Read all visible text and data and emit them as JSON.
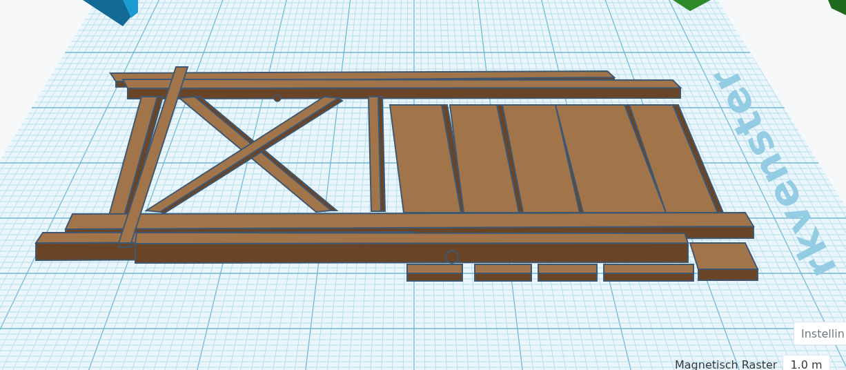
{
  "workplane": {
    "label": "rkvenster"
  },
  "settings_button": {
    "label": "Instellin"
  },
  "snap_grid": {
    "label": "Magnetisch Raster",
    "value": "1.0 m"
  }
}
